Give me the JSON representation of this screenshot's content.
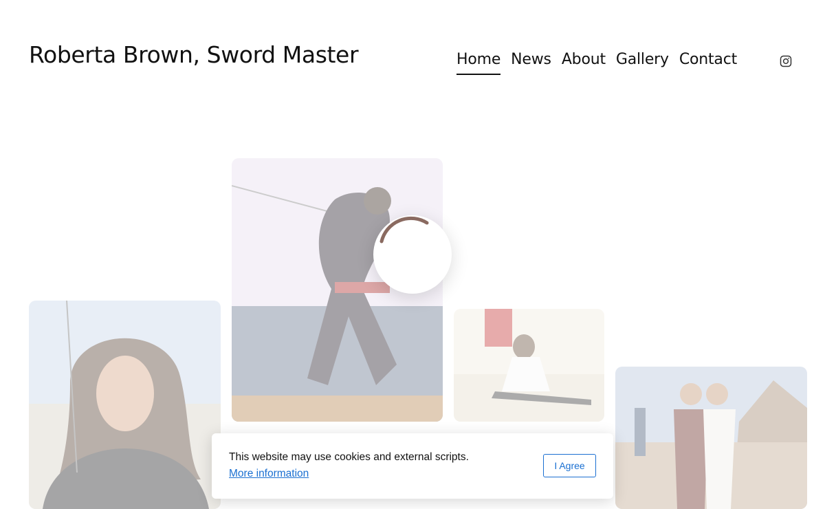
{
  "site": {
    "title": "Roberta Brown, Sword Master"
  },
  "nav": {
    "items": [
      {
        "label": "Home",
        "active": true
      },
      {
        "label": "News"
      },
      {
        "label": "About"
      },
      {
        "label": "Gallery"
      },
      {
        "label": "Contact"
      }
    ],
    "social_icon": "instagram-icon"
  },
  "gallery": {
    "tiles": [
      {
        "subject": "portrait-curly-hair-leather-jacket-beach"
      },
      {
        "subject": "sword-fencer-pose-ocean"
      },
      {
        "subject": "woman-stretching-splits-beach"
      },
      {
        "subject": "two-women-pirate-costumes"
      }
    ],
    "loading_icon": "loading-spinner-icon"
  },
  "cookie_banner": {
    "message": "This website may use cookies and external scripts.",
    "link_text": "More information",
    "button_label": "I Agree"
  },
  "colors": {
    "link": "#1a6fd1",
    "spinner": "#8a6a60",
    "text": "#111111"
  }
}
